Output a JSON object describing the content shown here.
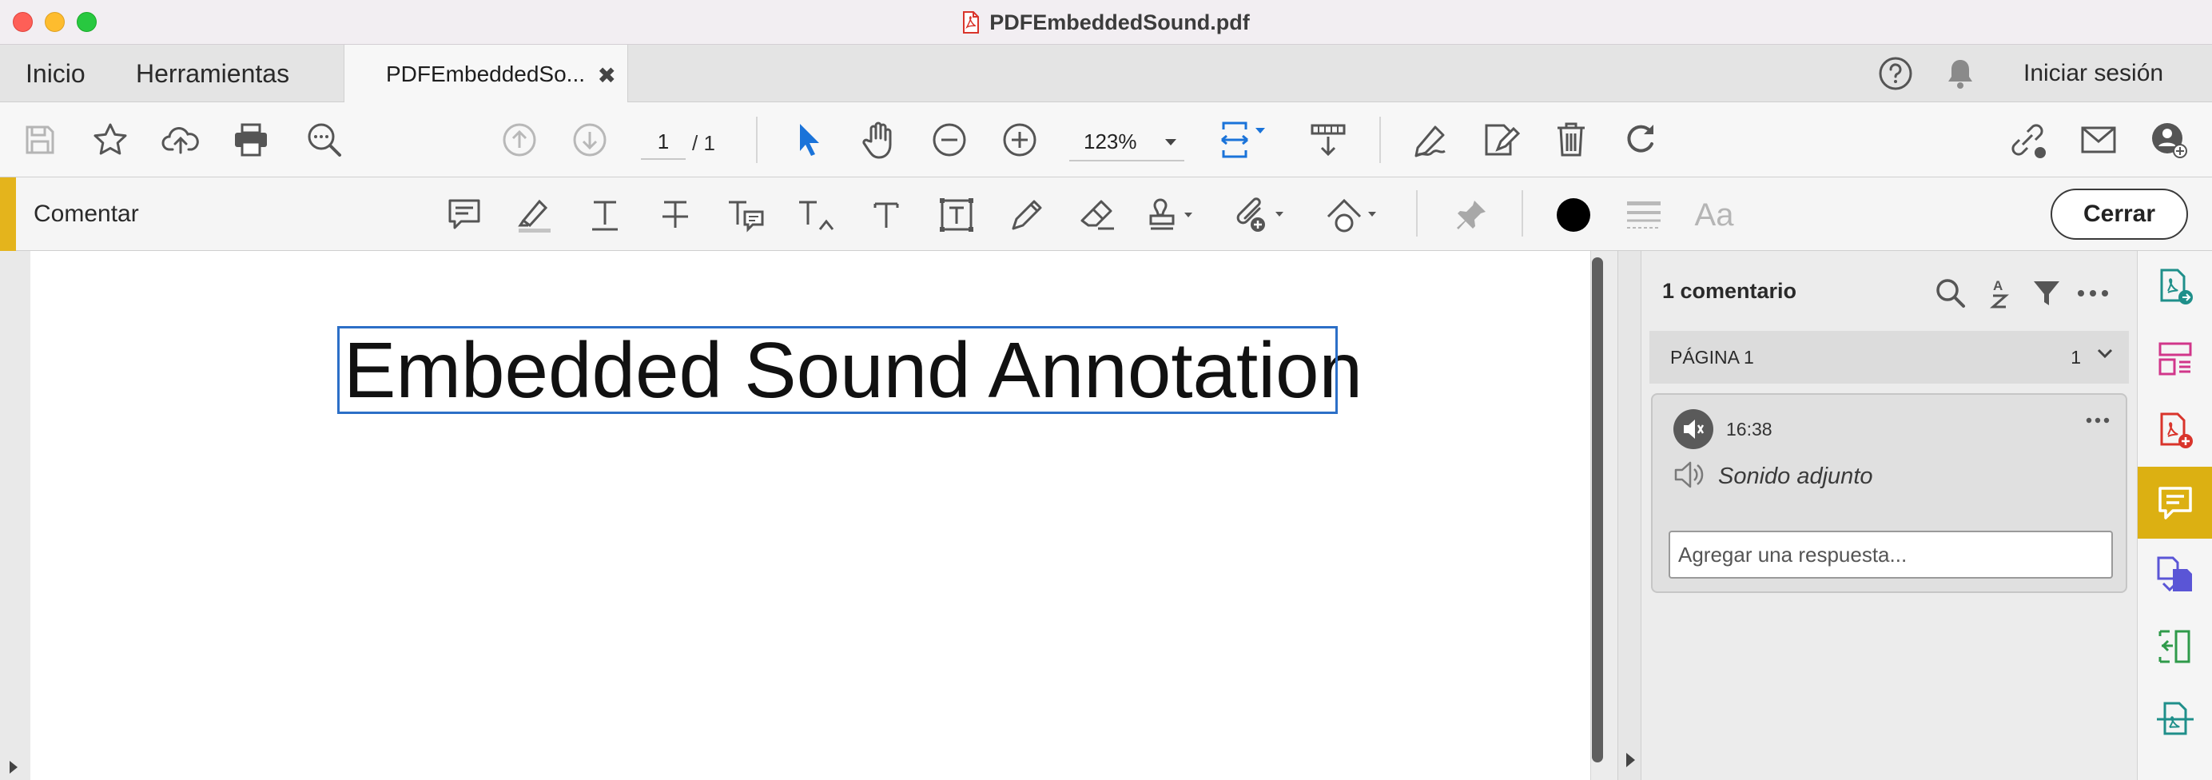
{
  "window": {
    "title": "PDFEmbeddedSound.pdf"
  },
  "tabs": {
    "home": "Inicio",
    "tools": "Herramientas",
    "document": "PDFEmbeddedSo...",
    "close_glyph": "✖",
    "sign_in": "Iniciar sesión"
  },
  "toolbar": {
    "current_page": "1",
    "page_total": "/  1",
    "zoom": "123%"
  },
  "comment_toolbar": {
    "title": "Comentar",
    "close_label": "Cerrar",
    "font_label": "Aa",
    "colors": {
      "accent": "#e4b41c",
      "text_color": "#000000"
    }
  },
  "document": {
    "annotation_text": "Embedded Sound Annotation"
  },
  "comments_panel": {
    "header": "1 comentario",
    "page_group_label": "PÁGINA 1",
    "page_group_count": "1",
    "comment": {
      "time": "16:38",
      "text": "Sonido adjunto",
      "reply_placeholder": "Agregar una respuesta..."
    }
  },
  "right_rail": {
    "items": [
      "export-pdf-icon",
      "organize-pages-icon",
      "create-pdf-icon",
      "comment-icon",
      "combine-files-icon",
      "compress-icon",
      "scan-icon"
    ],
    "active": "comment-icon"
  }
}
